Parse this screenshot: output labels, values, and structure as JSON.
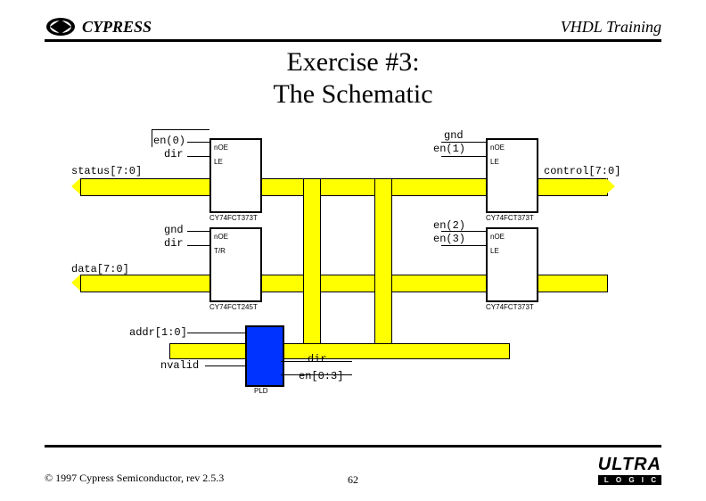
{
  "header": {
    "brand": "CYPRESS",
    "right": "VHDL Training"
  },
  "title": {
    "line1": "Exercise #3:",
    "line2": "The Schematic"
  },
  "signals": {
    "en0": "en(0)",
    "dir": "dir",
    "gnd": "gnd",
    "en1": "en(1)",
    "status": "status[7:0]",
    "control": "control[7:0]",
    "en2": "en(2)",
    "en3": "en(3)",
    "data": "data[7:0]",
    "addr": "addr[1:0]",
    "nvalid": "nvalid",
    "dir_out": "dir",
    "en_bus": "en[0:3]"
  },
  "chips": {
    "c373": "CY74FCT373T",
    "c245": "CY74FCT245T",
    "pld": "PLD",
    "noe": "nOE",
    "le": "LE",
    "tr": "T/R"
  },
  "footer": {
    "copyright": "© 1997 Cypress Semiconductor, rev 2.5.3",
    "page": "62",
    "ultra": "ULTRA",
    "ultra_sub": "L O G I C"
  }
}
